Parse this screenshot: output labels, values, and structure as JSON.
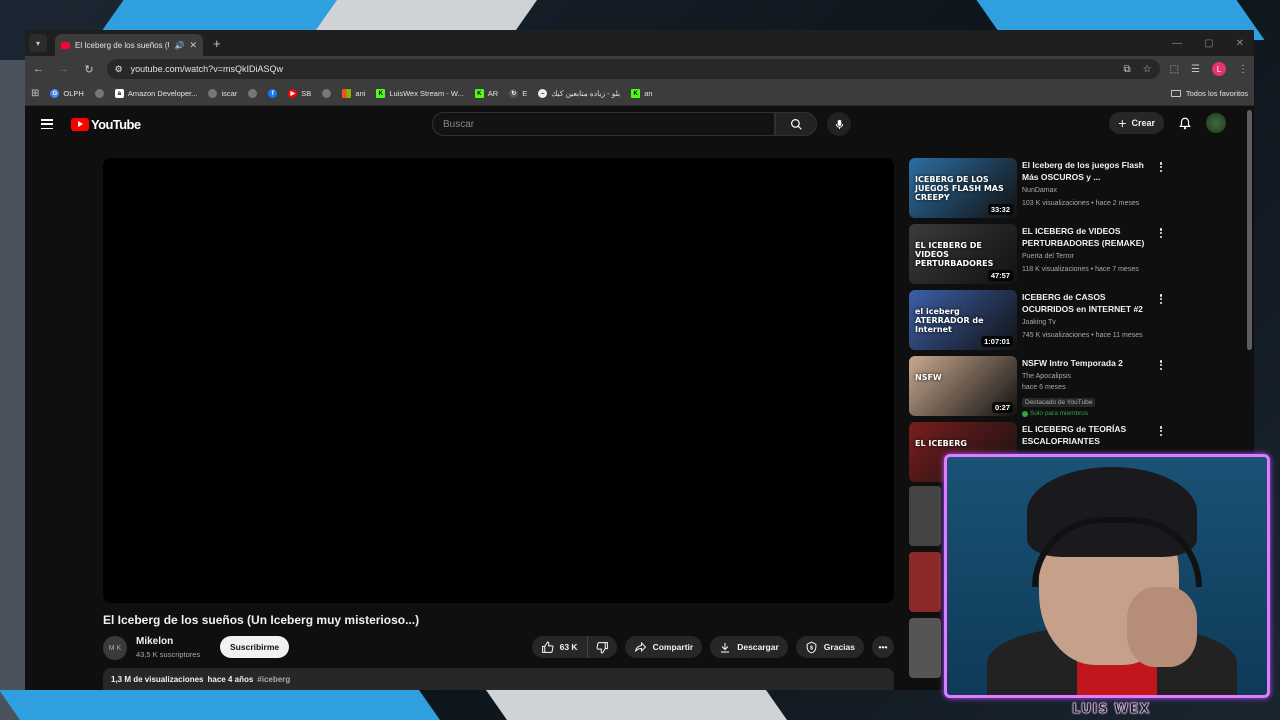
{
  "browser": {
    "tab_title": "El Iceberg de los sueños (Un",
    "url": "youtube.com/watch?v=msQkIDiASQw",
    "bookmarks": [
      "OLPH",
      "",
      "Amazon Developer...",
      "iscar",
      "",
      "",
      "SB",
      "",
      "ani",
      "LuisWex Stream - W...",
      "AR",
      "E",
      "بلو - زياده متابعين كيك",
      "an"
    ],
    "bookmarks_folder": "Todos los favoritos",
    "profile_initial": "L"
  },
  "youtube": {
    "logo_text": "YouTube",
    "search_placeholder": "Buscar",
    "create_label": "Crear"
  },
  "video": {
    "title": "El Iceberg de los sueños (Un Iceberg muy misterioso...)",
    "channel": "Mikelon",
    "channel_avatar_text": "M K",
    "subscribers": "43,5 K suscriptores",
    "subscribe_label": "Suscribirme",
    "likes": "63 K",
    "share_label": "Compartir",
    "download_label": "Descargar",
    "thanks_label": "Gracias",
    "views": "1,3 M de visualizaciones",
    "age": "hace 4 años",
    "hashtag": "#iceberg"
  },
  "related": [
    {
      "title": "El Iceberg de los juegos Flash Más OSCUROS y ...",
      "channel": "NunDamax",
      "meta": "103 K visualizaciones • hace 2 meses",
      "duration": "33:32",
      "thumb_text": "ICEBERG DE LOS JUEGOS FLASH MAS CREEPY",
      "color": "#2d6ea3"
    },
    {
      "title": "EL ICEBERG de VIDEOS PERTURBADORES (REMAKE)",
      "channel": "Puerta del Terror",
      "meta": "118 K visualizaciones • hace 7 meses",
      "duration": "47:57",
      "thumb_text": "EL ICEBERG DE VIDEOS PERTURBADORES",
      "color": "#3b3b3b"
    },
    {
      "title": "ICEBERG de CASOS OCURRIDOS en INTERNET #2",
      "channel": "Joaking Tv",
      "meta": "745 K visualizaciones • hace 11 meses",
      "duration": "1:07:01",
      "thumb_text": "el iceberg ATERRADOR de Internet",
      "color": "#3c5fa8"
    },
    {
      "title": "NSFW Intro Temporada 2",
      "channel": "The Apocalipsis",
      "meta": "hace 6 meses",
      "duration": "0:27",
      "thumb_text": "NSFW",
      "color": "#c9a98f",
      "badge": "Destacado de YouTube",
      "member": "Solo para miembros"
    },
    {
      "title": "EL ICEBERG de TEORÍAS ESCALOFRIANTES",
      "channel": "",
      "meta": "",
      "duration": "",
      "thumb_text": "EL ICEBERG",
      "color": "#7a1e1e"
    }
  ],
  "webcam": {
    "name_tag": "LUIS WEX"
  }
}
